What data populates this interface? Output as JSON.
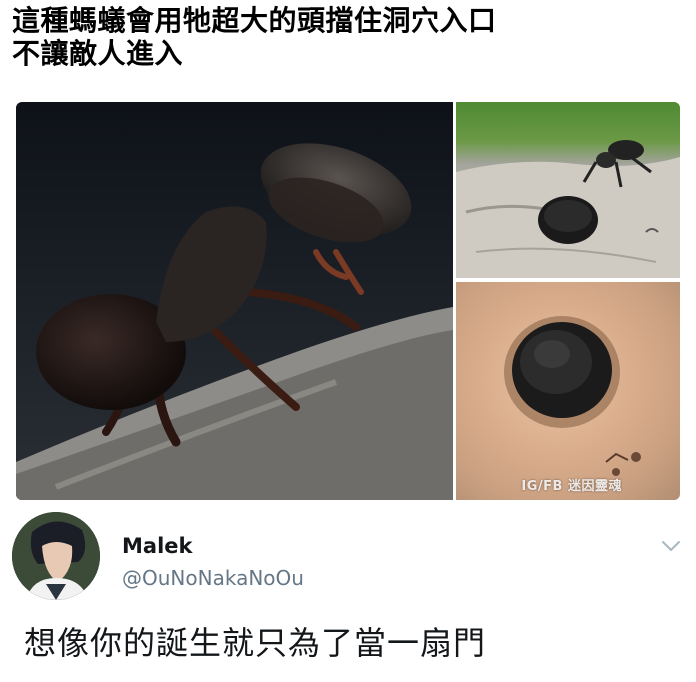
{
  "caption": {
    "line1": "這種螞蟻會用牠超大的頭擋住洞穴入口",
    "line2": "不讓敵人進入"
  },
  "photos": {
    "watermark": "IG/FB 迷因靈魂"
  },
  "tweet": {
    "name": "Malek",
    "handle": "@OuNoNakaNoOu",
    "text": "想像你的誕生就只為了當一扇門",
    "menu_icon": "chevron-down-icon",
    "handle_color": "#657786"
  }
}
